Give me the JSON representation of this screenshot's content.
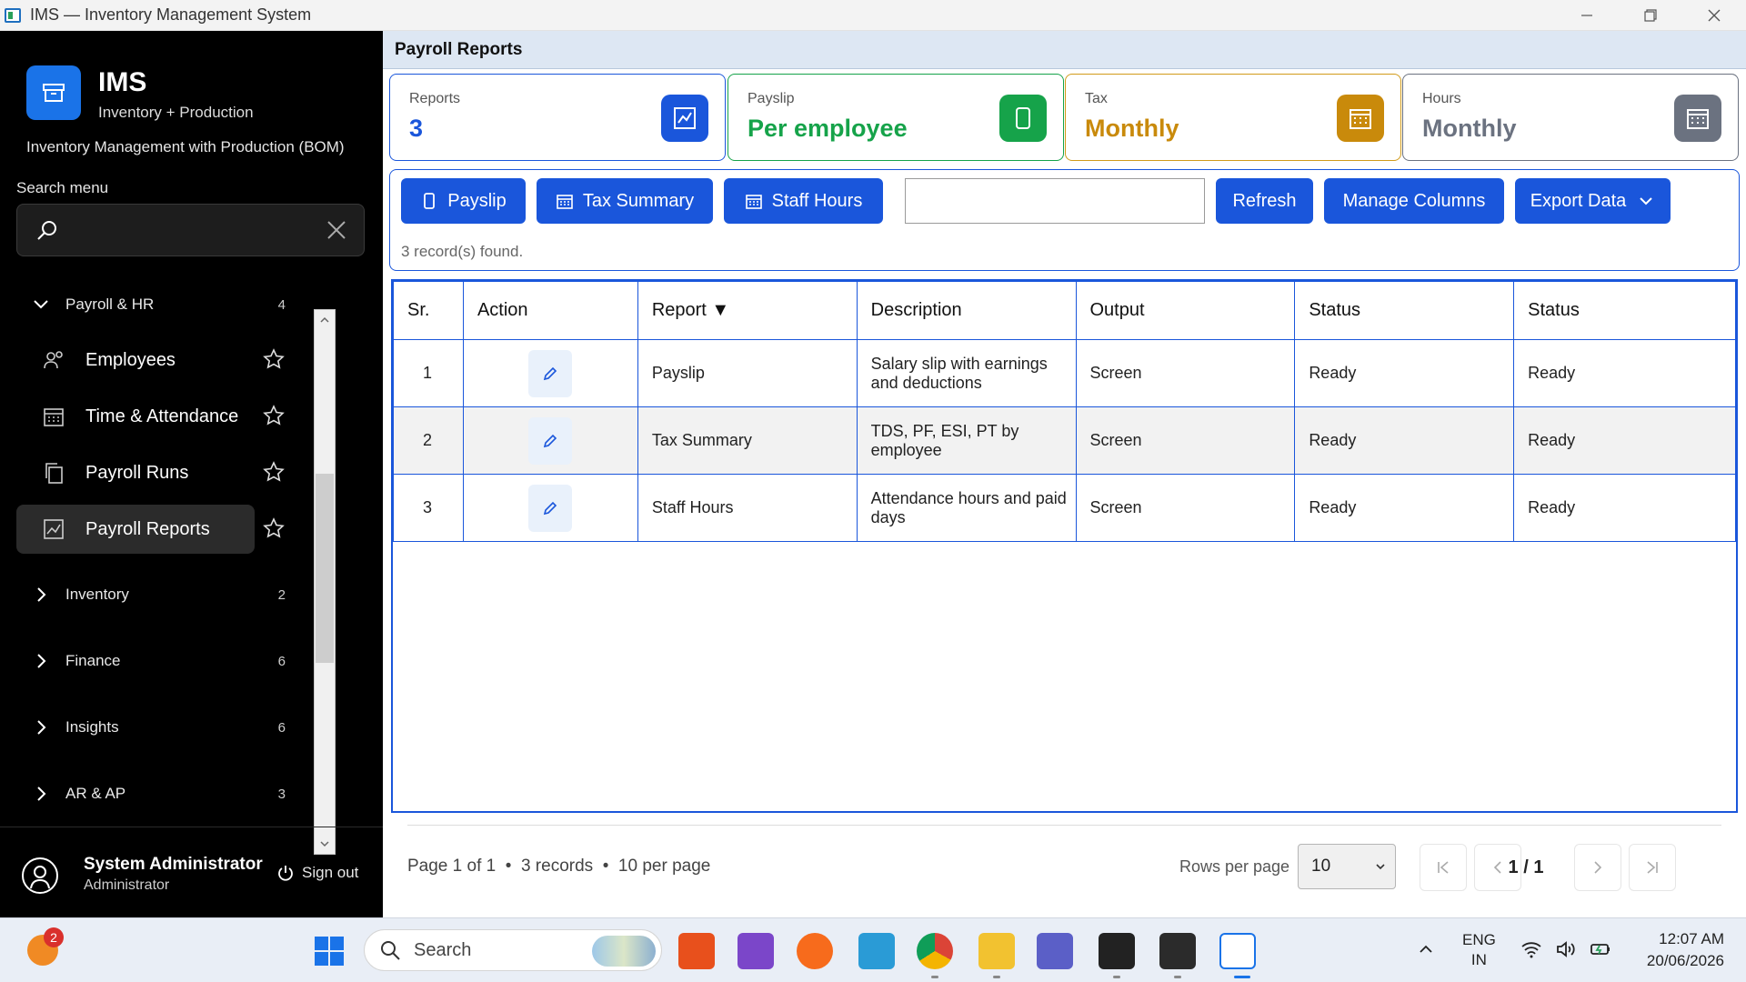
{
  "window": {
    "title": "IMS — Inventory Management System"
  },
  "sidebar": {
    "brand_name": "IMS",
    "brand_sub": "Inventory + Production",
    "brand_desc": "Inventory Management with Production (BOM)",
    "search_label": "Search menu",
    "search_value": "",
    "groups": [
      {
        "label": "Payroll & HR",
        "count": "4",
        "expanded": true
      },
      {
        "label": "Inventory",
        "count": "2",
        "expanded": false
      },
      {
        "label": "Finance",
        "count": "6",
        "expanded": false
      },
      {
        "label": "Insights",
        "count": "6",
        "expanded": false
      },
      {
        "label": "AR & AP",
        "count": "3",
        "expanded": false
      }
    ],
    "items": [
      {
        "label": "Employees",
        "icon": "people-icon",
        "active": false
      },
      {
        "label": "Time & Attendance",
        "icon": "calendar-icon",
        "active": false
      },
      {
        "label": "Payroll Runs",
        "icon": "copy-icon",
        "active": false
      },
      {
        "label": "Payroll Reports",
        "icon": "chart-icon",
        "active": true
      }
    ],
    "user": {
      "name": "System Administrator",
      "role": "Administrator",
      "signout": "Sign out"
    }
  },
  "main": {
    "title": "Payroll Reports",
    "cards": [
      {
        "label": "Reports",
        "value": "3",
        "color": "#1a56db",
        "icon": "chart-icon"
      },
      {
        "label": "Payslip",
        "value": "Per employee",
        "color": "#16a34a",
        "icon": "phone-icon"
      },
      {
        "label": "Tax",
        "value": "Monthly",
        "color": "#c98a0b",
        "icon": "calendar-icon"
      },
      {
        "label": "Hours",
        "value": "Monthly",
        "color": "#6b7280",
        "icon": "calendar-icon"
      }
    ],
    "toolbar": {
      "payslip": "Payslip",
      "tax_summary": "Tax Summary",
      "staff_hours": "Staff Hours",
      "filter_value": "",
      "refresh": "Refresh",
      "manage_columns": "Manage Columns",
      "export_data": "Export Data"
    },
    "records_found": "3 record(s) found.",
    "table": {
      "headers": [
        "Sr.",
        "Action",
        "Report ▼",
        "Description",
        "Output",
        "Status",
        "Status"
      ],
      "rows": [
        {
          "sr": "1",
          "report": "Payslip",
          "description": "Salary slip with earnings and deductions",
          "output": "Screen",
          "status1": "Ready",
          "status2": "Ready"
        },
        {
          "sr": "2",
          "report": "Tax Summary",
          "description": "TDS, PF, ESI, PT by employee",
          "output": "Screen",
          "status1": "Ready",
          "status2": "Ready"
        },
        {
          "sr": "3",
          "report": "Staff Hours",
          "description": "Attendance hours and paid days",
          "output": "Screen",
          "status1": "Ready",
          "status2": "Ready"
        }
      ]
    },
    "pager": {
      "summary": "Page 1 of 1  •  3 records  •  10 per page",
      "rows_per_page_label": "Rows per page",
      "rows_per_page": "10",
      "page_info": "1 / 1"
    }
  },
  "taskbar": {
    "weather_badge": "2",
    "search_label": "Search",
    "lang_line1": "ENG",
    "lang_line2": "IN",
    "time": "12:07 AM",
    "date": "20/06/2026"
  }
}
